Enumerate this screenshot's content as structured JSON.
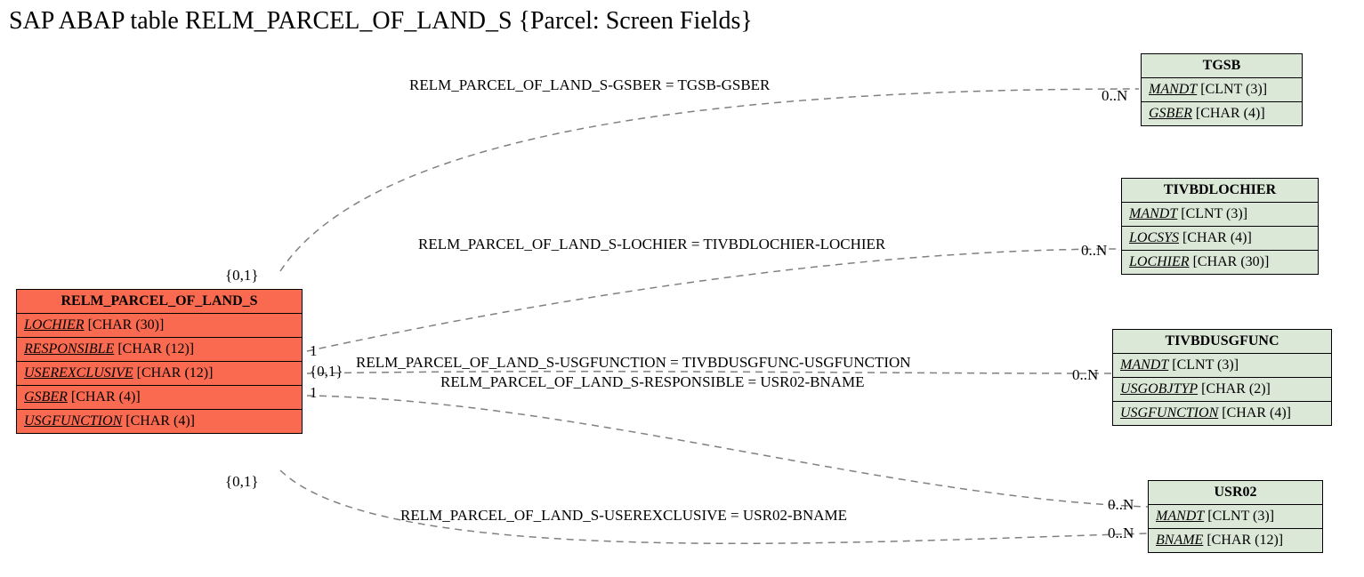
{
  "title": "SAP ABAP table RELM_PARCEL_OF_LAND_S {Parcel: Screen Fields}",
  "main_entity": {
    "name": "RELM_PARCEL_OF_LAND_S",
    "fields": [
      {
        "name": "LOCHIER",
        "type": "[CHAR (30)]"
      },
      {
        "name": "RESPONSIBLE",
        "type": "[CHAR (12)]"
      },
      {
        "name": "USEREXCLUSIVE",
        "type": "[CHAR (12)]"
      },
      {
        "name": "GSBER",
        "type": "[CHAR (4)]"
      },
      {
        "name": "USGFUNCTION",
        "type": "[CHAR (4)]"
      }
    ]
  },
  "entities": {
    "tgsb": {
      "name": "TGSB",
      "fields": [
        {
          "name": "MANDT",
          "type": "[CLNT (3)]"
        },
        {
          "name": "GSBER",
          "type": "[CHAR (4)]"
        }
      ]
    },
    "tivbdlochier": {
      "name": "TIVBDLOCHIER",
      "fields": [
        {
          "name": "MANDT",
          "type": "[CLNT (3)]"
        },
        {
          "name": "LOCSYS",
          "type": "[CHAR (4)]"
        },
        {
          "name": "LOCHIER",
          "type": "[CHAR (30)]"
        }
      ]
    },
    "tivbdusgfunc": {
      "name": "TIVBDUSGFUNC",
      "fields": [
        {
          "name": "MANDT",
          "type": "[CLNT (3)]"
        },
        {
          "name": "USGOBJTYP",
          "type": "[CHAR (2)]"
        },
        {
          "name": "USGFUNCTION",
          "type": "[CHAR (4)]"
        }
      ]
    },
    "usr02": {
      "name": "USR02",
      "fields": [
        {
          "name": "MANDT",
          "type": "[CLNT (3)]"
        },
        {
          "name": "BNAME",
          "type": "[CHAR (12)]"
        }
      ]
    }
  },
  "edges": {
    "e1": {
      "label": "RELM_PARCEL_OF_LAND_S-GSBER = TGSB-GSBER",
      "left_card": "{0,1}",
      "right_card": "0..N"
    },
    "e2": {
      "label": "RELM_PARCEL_OF_LAND_S-LOCHIER = TIVBDLOCHIER-LOCHIER",
      "left_card": "1",
      "right_card": "0..N"
    },
    "e3": {
      "label": "RELM_PARCEL_OF_LAND_S-USGFUNCTION = TIVBDUSGFUNC-USGFUNCTION",
      "left_card": "{0,1}",
      "right_card": "0..N"
    },
    "e4": {
      "label": "RELM_PARCEL_OF_LAND_S-RESPONSIBLE = USR02-BNAME",
      "left_card": "1",
      "right_card": "0..N"
    },
    "e5": {
      "label": "RELM_PARCEL_OF_LAND_S-USEREXCLUSIVE = USR02-BNAME",
      "left_card": "{0,1}",
      "right_card": "0..N"
    }
  }
}
